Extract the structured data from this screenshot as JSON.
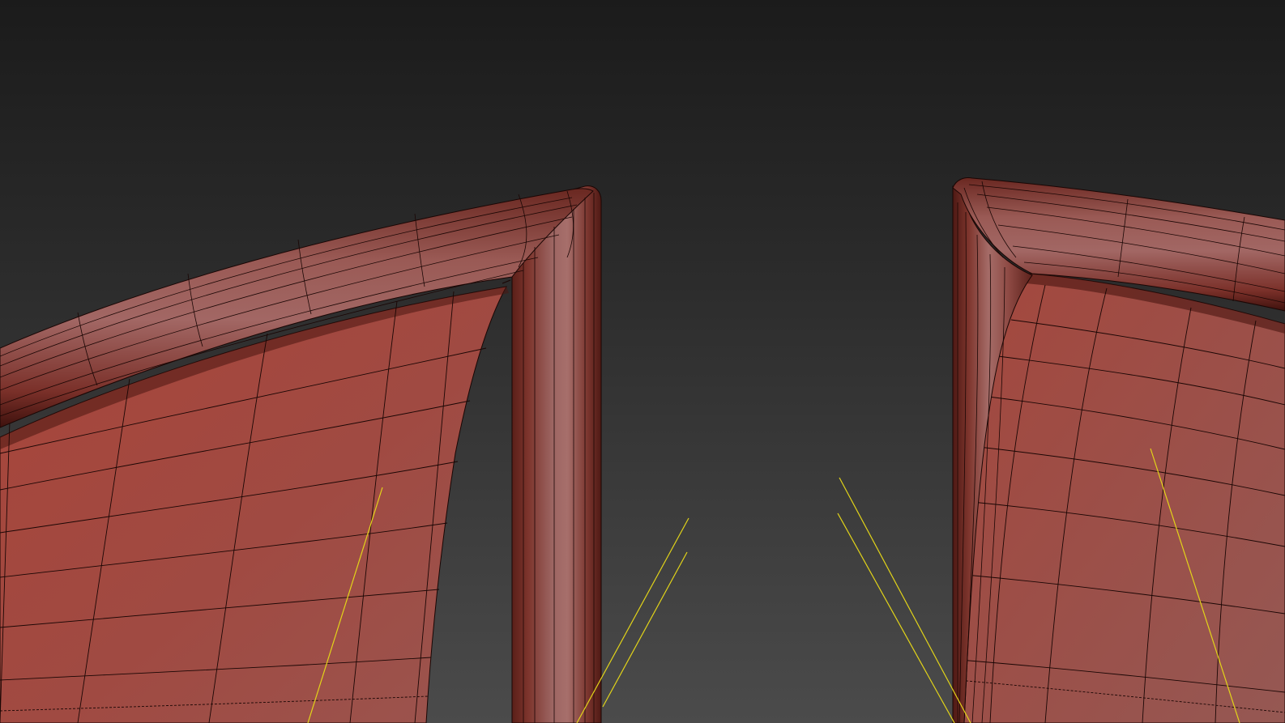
{
  "viewport": {
    "label": "",
    "background": {
      "top_color": "#1b1b1b",
      "bottom_color": "#4b4b4b"
    },
    "mesh_color": "#a8473a",
    "wire_color": "#1a0604",
    "gizmo_color": "#e2d419",
    "visible_objects": [
      {
        "name": "left-wing-frame",
        "type": "editable-mesh"
      },
      {
        "name": "left-wing-seat-panel",
        "type": "editable-mesh"
      },
      {
        "name": "right-wing-frame",
        "type": "editable-mesh"
      },
      {
        "name": "right-wing-seat-panel",
        "type": "editable-mesh"
      }
    ]
  }
}
